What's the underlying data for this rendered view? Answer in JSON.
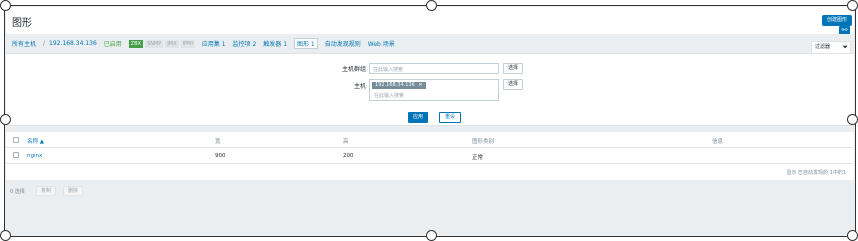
{
  "header": {
    "title": "图形",
    "create_button": "创建图形"
  },
  "nav": {
    "all_hosts": "所有主机",
    "separator": "/",
    "host_ip": "192.168.34.136",
    "status": "已启用",
    "tags": [
      "ZBX",
      "SNMP",
      "JMX",
      "IPMI"
    ],
    "apps": "应用集 1",
    "items": "监控项 2",
    "triggers": "触发器 1",
    "graphs": "图形 1",
    "discovery": "自动发现规则",
    "web": "Web 场景"
  },
  "filter": {
    "tab_label": "过滤器",
    "host_group_label": "主机群组",
    "host_group_placeholder": "在此输入搜索",
    "host_label": "主机",
    "host_chip": "192.168.34.136",
    "host_placeholder": "在此输入搜索",
    "select_label": "选择",
    "apply_label": "应用",
    "reset_label": "重设"
  },
  "table": {
    "headers": {
      "name": "名称 ▲",
      "width": "宽",
      "height": "高",
      "graph_type": "图形类别",
      "info": "信息"
    },
    "rows": [
      {
        "name": "nginx",
        "width": "900",
        "height": "200",
        "graph_type": "正常"
      }
    ],
    "footer": "显示 已自动发现的 1中的1"
  },
  "bulk": {
    "selected": "0 选择",
    "copy": "复制",
    "delete": "删除"
  },
  "colors": {
    "primary": "#0275b8",
    "enabled": "#429e47",
    "background": "#ebeef0"
  }
}
